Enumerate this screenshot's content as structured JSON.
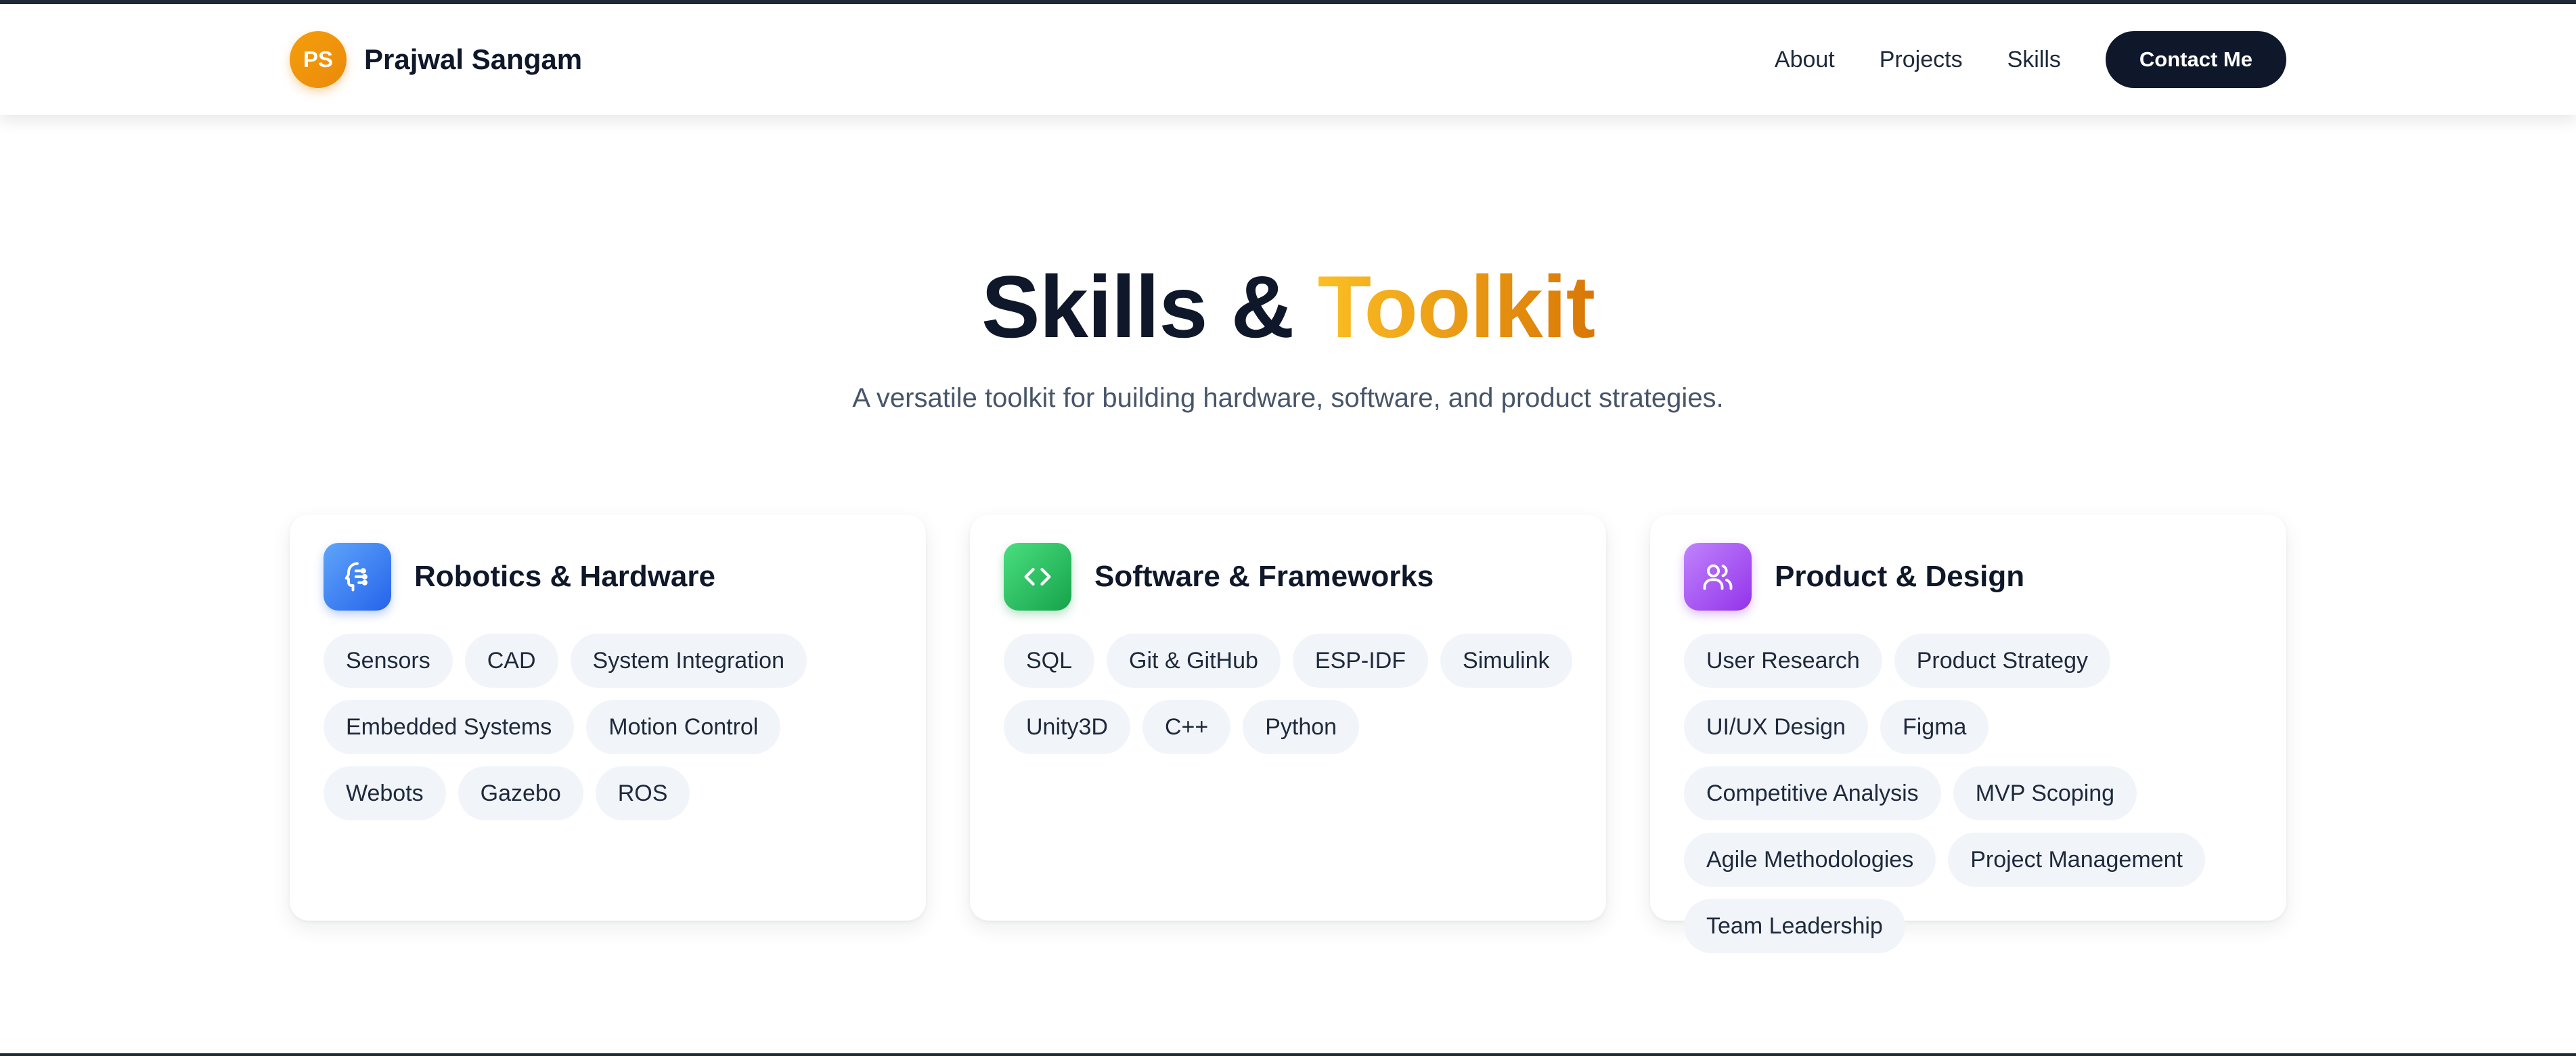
{
  "header": {
    "avatar_initials": "PS",
    "name": "Prajwal Sangam",
    "nav": [
      {
        "label": "About"
      },
      {
        "label": "Projects"
      },
      {
        "label": "Skills"
      }
    ],
    "contact_label": "Contact Me"
  },
  "section": {
    "title_part1": "Skills & ",
    "title_accent": "Toolkit",
    "subtitle": "A versatile toolkit for building hardware, software, and product strategies."
  },
  "cards": [
    {
      "title": "Robotics & Hardware",
      "icon": "robot-head-icon",
      "color": "#3b82f6",
      "skills": [
        "Sensors",
        "CAD",
        "System Integration",
        "Embedded Systems",
        "Motion Control",
        "Webots",
        "Gazebo",
        "ROS"
      ]
    },
    {
      "title": "Software & Frameworks",
      "icon": "code-icon",
      "color": "#22c55e",
      "skills": [
        "SQL",
        "Git & GitHub",
        "ESP-IDF",
        "Simulink",
        "Unity3D",
        "C++",
        "Python"
      ]
    },
    {
      "title": "Product & Design",
      "icon": "users-icon",
      "color": "#a855f7",
      "skills": [
        "User Research",
        "Product Strategy",
        "UI/UX Design",
        "Figma",
        "Competitive Analysis",
        "MVP Scoping",
        "Agile Methodologies",
        "Project Management",
        "Team Leadership"
      ]
    }
  ],
  "colors": {
    "accent_orange": "#f59e0b",
    "dark": "#0f172a",
    "chip_bg": "#f1f5f9"
  }
}
